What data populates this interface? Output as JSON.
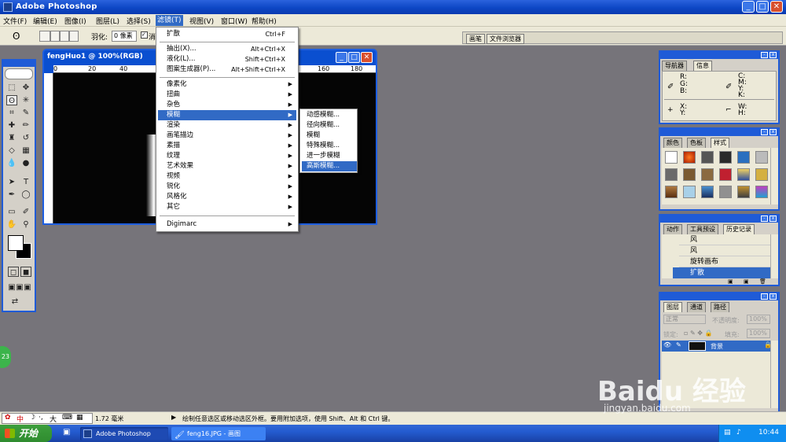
{
  "app": {
    "title": "Adobe Photoshop"
  },
  "menubar": [
    "文件(F)",
    "编辑(E)",
    "图像(I)",
    "图层(L)",
    "选择(S)",
    "滤镜(T)",
    "视图(V)",
    "窗口(W)",
    "帮助(H)"
  ],
  "options": {
    "feather_label": "羽化:",
    "feather_value": "0 像素",
    "check_label": "消"
  },
  "palette_well": [
    "画笔",
    "文件浏览器"
  ],
  "document": {
    "title": "fengHuo1 @ 100%(RGB)",
    "ruler_marks": [
      "0",
      "20",
      "40",
      "160",
      "180"
    ]
  },
  "filter_menu": [
    {
      "label": "扩散",
      "shortcut": "Ctrl+F"
    },
    {
      "label": "抽出(X)...",
      "shortcut": "Alt+Ctrl+X"
    },
    {
      "label": "液化(L)...",
      "shortcut": "Shift+Ctrl+X"
    },
    {
      "label": "图案生成器(P)...",
      "shortcut": "Alt+Shift+Ctrl+X"
    },
    {
      "label": "像素化"
    },
    {
      "label": "扭曲"
    },
    {
      "label": "杂色"
    },
    {
      "label": "模糊"
    },
    {
      "label": "渲染"
    },
    {
      "label": "画笔描边"
    },
    {
      "label": "素描"
    },
    {
      "label": "纹理"
    },
    {
      "label": "艺术效果"
    },
    {
      "label": "视频"
    },
    {
      "label": "锐化"
    },
    {
      "label": "风格化"
    },
    {
      "label": "其它"
    },
    {
      "label": "Digimarc"
    }
  ],
  "blur_submenu": [
    "动感模糊...",
    "径向模糊...",
    "模糊",
    "特殊模糊...",
    "进一步模糊",
    "高斯模糊..."
  ],
  "nav_panel": {
    "tabs": [
      "导航器",
      "信息"
    ],
    "labels": [
      "R:",
      "G:",
      "B:",
      "C:",
      "M:",
      "Y:",
      "K:",
      "X:",
      "Y:",
      "W:",
      "H:"
    ]
  },
  "color_panel": {
    "tabs": [
      "颜色",
      "色板",
      "样式"
    ]
  },
  "history_panel": {
    "tabs": [
      "动作",
      "工具预设",
      "历史记录"
    ],
    "items": [
      "风",
      "风",
      "旋转画布",
      "扩散"
    ]
  },
  "layers_panel": {
    "tabs": [
      "图层",
      "通道",
      "路径"
    ],
    "blend": "正常",
    "opacity_label": "不透明度:",
    "opacity": "100%",
    "lock_label": "锁定:",
    "fill_label": "填充:",
    "fill": "100%",
    "layer": "背景"
  },
  "status": {
    "zoom": "1.72 毫米",
    "hint": "绘制任意选区或移动选区外框。要用附加选项，使用 Shift、Alt 和 Ctrl 键。",
    "ime": "中",
    "ime_dot": "·,",
    "ime_big": "大"
  },
  "taskbar": {
    "start": "开始",
    "tasks": [
      "Adobe Photoshop",
      "feng16.JPG - 画图"
    ],
    "clock": "10:44"
  },
  "badge": "23",
  "watermark": {
    "brand": "Baidu 经验",
    "url": "jingyan.baidu.com"
  },
  "colors": {
    "xp_blue": "#1f5bd7",
    "menu_highlight": "#316ac5",
    "desktop": "#76747a"
  }
}
